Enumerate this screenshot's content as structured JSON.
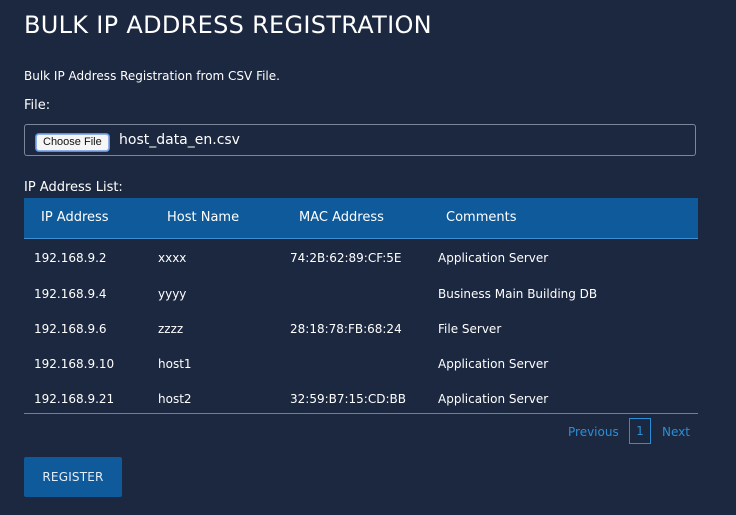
{
  "page": {
    "title": "BULK IP ADDRESS REGISTRATION",
    "description": "Bulk IP Address Registration from CSV File."
  },
  "file": {
    "label": "File:",
    "button_label": "Choose File",
    "file_name": "host_data_en.csv"
  },
  "list": {
    "label": "IP Address List:",
    "columns": [
      "IP Address",
      "Host Name",
      "MAC Address",
      "Comments"
    ],
    "rows": [
      [
        "192.168.9.2",
        "xxxx",
        "74:2B:62:89:CF:5E",
        "Application Server"
      ],
      [
        "192.168.9.4",
        "yyyy",
        "",
        "Business Main Building DB"
      ],
      [
        "192.168.9.6",
        "zzzz",
        "28:18:78:FB:68:24",
        "File Server"
      ],
      [
        "192.168.9.10",
        "host1",
        "",
        "Application Server"
      ],
      [
        "192.168.9.21",
        "host2",
        "32:59:B7:15:CD:BB",
        "Application Server"
      ]
    ]
  },
  "pagination": {
    "previous_label": "Previous",
    "current_page": "1",
    "next_label": "Next"
  },
  "actions": {
    "register_label": "REGISTER"
  },
  "colors": {
    "background": "#1b2840",
    "header_bg": "#0e5a9a",
    "link": "#2a8fd6"
  }
}
